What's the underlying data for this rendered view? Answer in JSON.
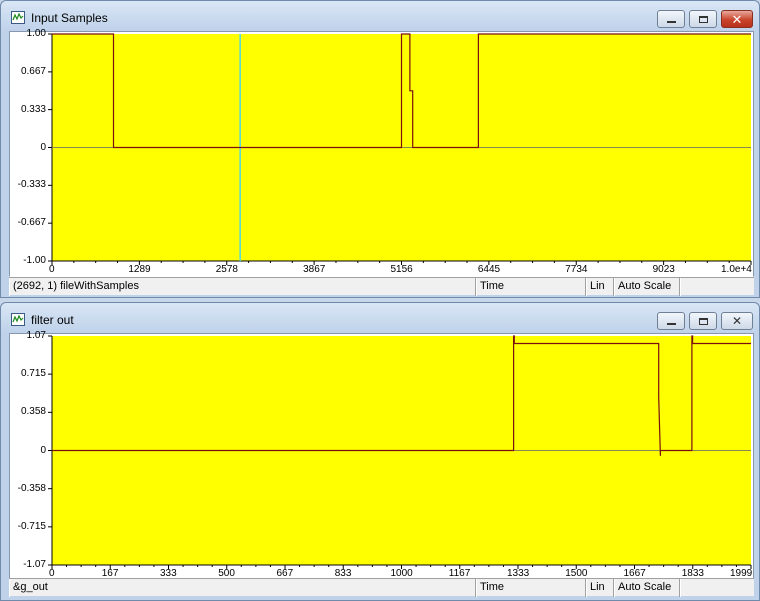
{
  "colors": {
    "plot_bg": "#ffff00",
    "trace": "#7a1010",
    "cursor": "#4fd7e6",
    "axis": "#000000"
  },
  "window1": {
    "title": "Input Samples",
    "icon": "graph-icon",
    "y_ticks": [
      "1.00",
      "0.667",
      "0.333",
      "0",
      "-0.333",
      "-0.667",
      "-1.00"
    ],
    "x_ticks": [
      "0",
      "1289",
      "2578",
      "3867",
      "5156",
      "6445",
      "7734",
      "9023",
      "1.0e+4"
    ],
    "status": {
      "cursor": "(2692, 1)  fileWithSamples",
      "domain": "Time",
      "scale": "Lin",
      "mode": "Auto Scale",
      "extra": ""
    }
  },
  "window2": {
    "title": "filter out",
    "icon": "graph-icon",
    "y_ticks": [
      "1.07",
      "0.715",
      "0.358",
      "0",
      "-0.358",
      "-0.715",
      "-1.07"
    ],
    "x_ticks": [
      "0",
      "167",
      "333",
      "500",
      "667",
      "833",
      "1000",
      "1167",
      "1333",
      "1500",
      "1667",
      "1833",
      "1999"
    ],
    "status": {
      "cursor": "&g_out",
      "domain": "Time",
      "scale": "Lin",
      "mode": "Auto Scale",
      "extra": ""
    }
  },
  "chart_data": [
    {
      "type": "line",
      "title": "Input Samples",
      "xlabel": "",
      "ylabel": "",
      "xlim": [
        0,
        10000
      ],
      "ylim": [
        -1.0,
        1.0
      ],
      "x": [
        0,
        880,
        880,
        5000,
        5000,
        5120,
        5120,
        5160,
        5160,
        6100,
        6100,
        10000
      ],
      "y": [
        1.0,
        1.0,
        0,
        0,
        1.0,
        1.0,
        0.5,
        0.5,
        0,
        0,
        1.0,
        1.0
      ],
      "cursor_x": 2692,
      "grid": false
    },
    {
      "type": "line",
      "title": "filter out",
      "xlabel": "",
      "ylabel": "",
      "xlim": [
        0,
        1999
      ],
      "ylim": [
        -1.07,
        1.07
      ],
      "x": [
        0,
        1320,
        1320,
        1322,
        1322,
        1735,
        1735,
        1740,
        1740,
        1830,
        1830,
        1832,
        1832,
        1999
      ],
      "y": [
        0,
        0,
        1.07,
        1.07,
        1.0,
        1.0,
        0.5,
        -0.05,
        0,
        0,
        1.07,
        1.07,
        1.0,
        1.0
      ],
      "grid": false
    }
  ]
}
